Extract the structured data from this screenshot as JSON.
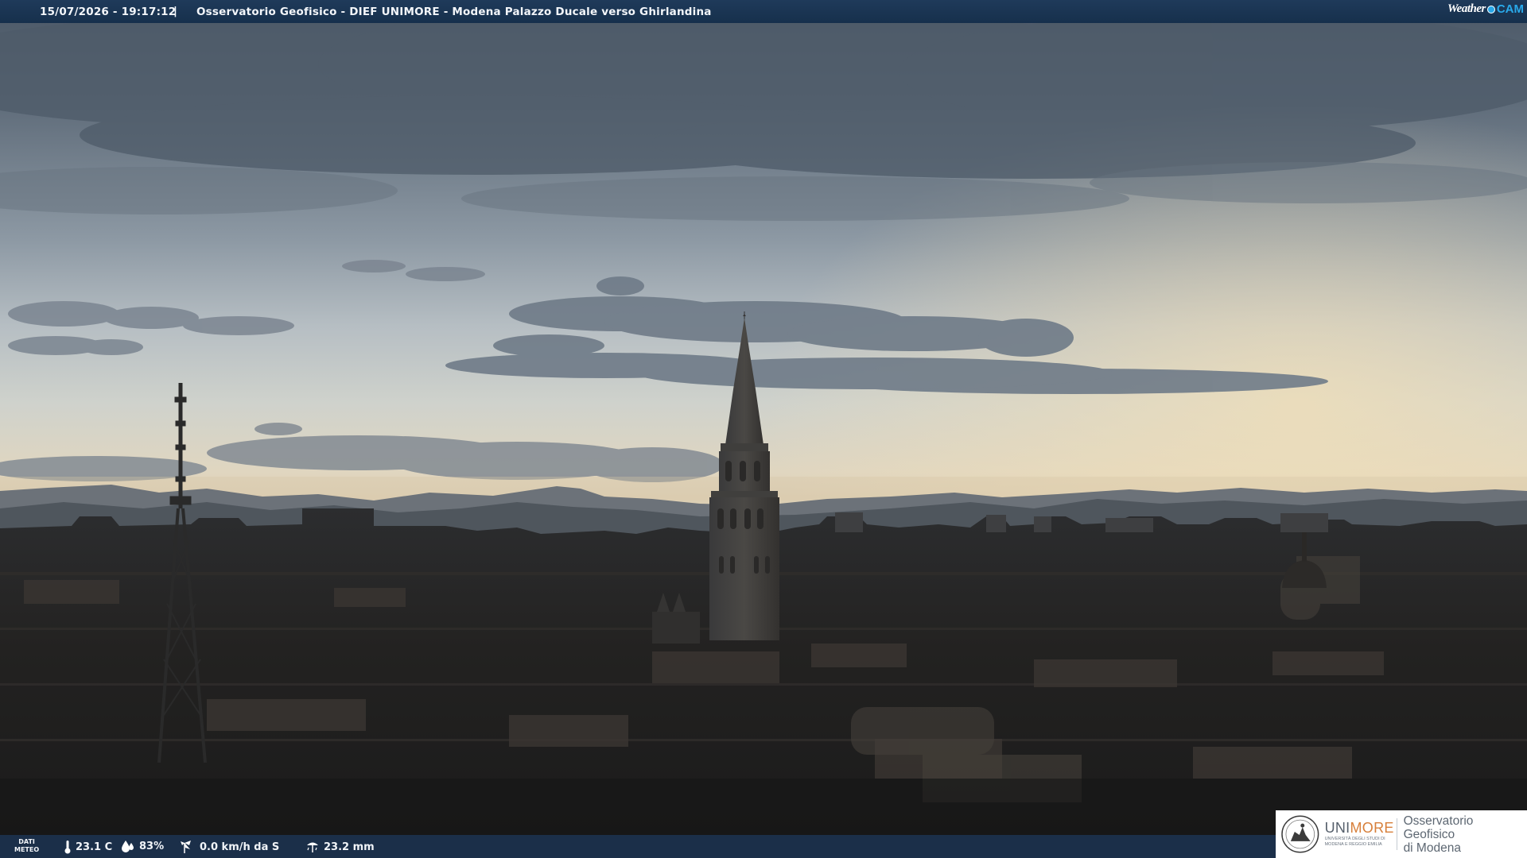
{
  "header": {
    "timestamp": "15/07/2026 - 19:17:12",
    "separator": "|",
    "title": "Osservatorio Geofisico - DIEF UNIMORE - Modena Palazzo Ducale verso Ghirlandina",
    "brand_weather": "Weather",
    "brand_cam": "CAM"
  },
  "weather": {
    "label_line1": "DATI",
    "label_line2": "METEO",
    "temperature": "23.1 C",
    "humidity": "83%",
    "wind": "0.0 km/h da S",
    "rain": "23.2 mm"
  },
  "logo": {
    "unimore_part1": "UNI",
    "unimore_part2": "MORE",
    "university_line1": "UNIVERSITÀ DEGLI STUDI DI",
    "university_line2": "MODENA E REGGIO EMILIA",
    "observatory_line1": "Osservatorio Geofisico",
    "observatory_line2": "di Modena"
  },
  "icons": [
    "thermometer-icon",
    "humidity-drop-icon",
    "wind-icon",
    "rain-gauge-icon",
    "university-seal-icon"
  ]
}
